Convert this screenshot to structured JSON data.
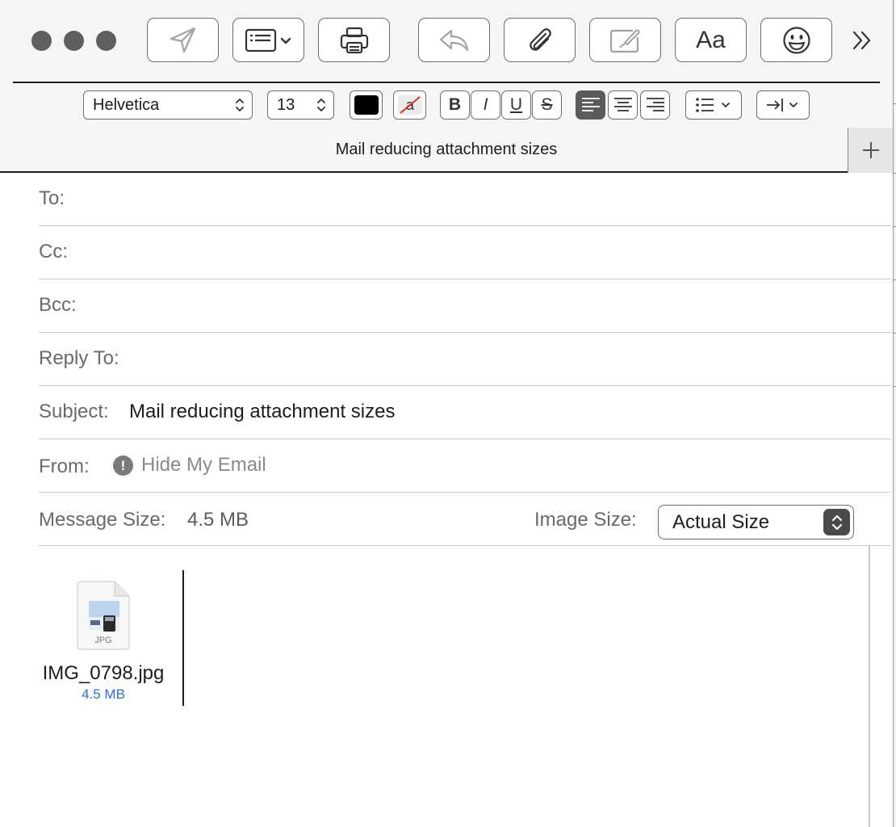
{
  "window": {
    "title": "Mail reducing attachment sizes"
  },
  "toolbar": {
    "icons": [
      "send-icon",
      "header-fields-icon",
      "print-icon",
      "reply-icon",
      "attachment-icon",
      "markup-icon",
      "format-icon",
      "emoji-icon",
      "overflow-icon"
    ],
    "format_label": "Aa"
  },
  "format_bar": {
    "font_name": "Helvetica",
    "font_size": "13",
    "text_color": "#000000",
    "bold": "B",
    "italic": "I",
    "underline": "U",
    "strikethrough": "S",
    "alignment": "left"
  },
  "headers": {
    "to_label": "To:",
    "cc_label": "Cc:",
    "bcc_label": "Bcc:",
    "reply_to_label": "Reply To:",
    "subject_label": "Subject:",
    "subject_value": "Mail reducing attachment sizes",
    "from_label": "From:",
    "from_value": "Hide My Email",
    "message_size_label": "Message Size:",
    "message_size_value": "4.5 MB",
    "image_size_label": "Image Size:",
    "image_size_value": "Actual Size"
  },
  "attachment": {
    "type_label": "JPG",
    "file_name": "IMG_0798.jpg",
    "file_size": "4.5 MB"
  },
  "colors": {
    "link_blue": "#2f6fd0",
    "toolbar_bg": "#f5f5f5",
    "traffic_light": "#5f5f5f"
  }
}
